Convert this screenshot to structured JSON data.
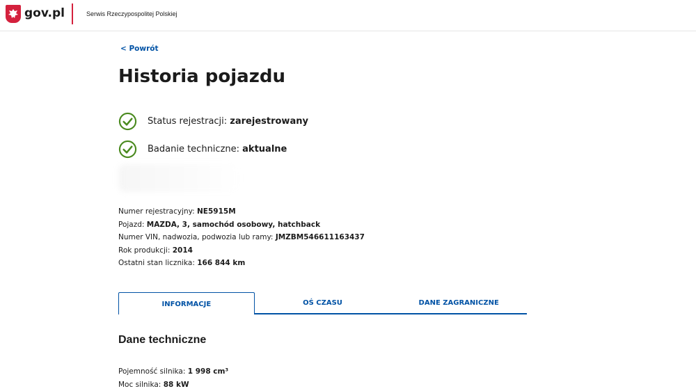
{
  "header": {
    "brand": "gov.pl",
    "service": "Serwis Rzeczypospolitej Polskiej",
    "emblem_icon": "polish-eagle-emblem"
  },
  "back_link": "< Powrót",
  "page_title": "Historia pojazdu",
  "statuses": [
    {
      "label": "Status rejestracji:",
      "value": "zarejestrowany",
      "icon": "check-circle-icon"
    },
    {
      "label": "Badanie techniczne:",
      "value": "aktualne",
      "icon": "check-circle-icon"
    }
  ],
  "vehicle": [
    {
      "label": "Numer rejestracyjny:",
      "value": "NE5915M"
    },
    {
      "label": "Pojazd:",
      "value": "MAZDA, 3, samochód osobowy, hatchback"
    },
    {
      "label": "Numer VIN, nadwozia, podwozia lub ramy:",
      "value": "JMZBM546611163437"
    },
    {
      "label": "Rok produkcji:",
      "value": "2014"
    },
    {
      "label": "Ostatni stan licznika:",
      "value": "166 844 km"
    }
  ],
  "tabs": [
    {
      "label": "INFORMACJE",
      "active": true
    },
    {
      "label": "OŚ CZASU",
      "active": false
    },
    {
      "label": "DANE ZAGRANICZNE",
      "active": false
    }
  ],
  "section_title": "Dane techniczne",
  "technical": [
    {
      "label": "Pojemność silnika:",
      "value": "1 998 cm³"
    },
    {
      "label": "Moc silnika:",
      "value": "88 kW"
    }
  ],
  "colors": {
    "accent_blue": "#0052a5",
    "brand_red": "#d4213d",
    "status_green": "#4a8a1f"
  }
}
